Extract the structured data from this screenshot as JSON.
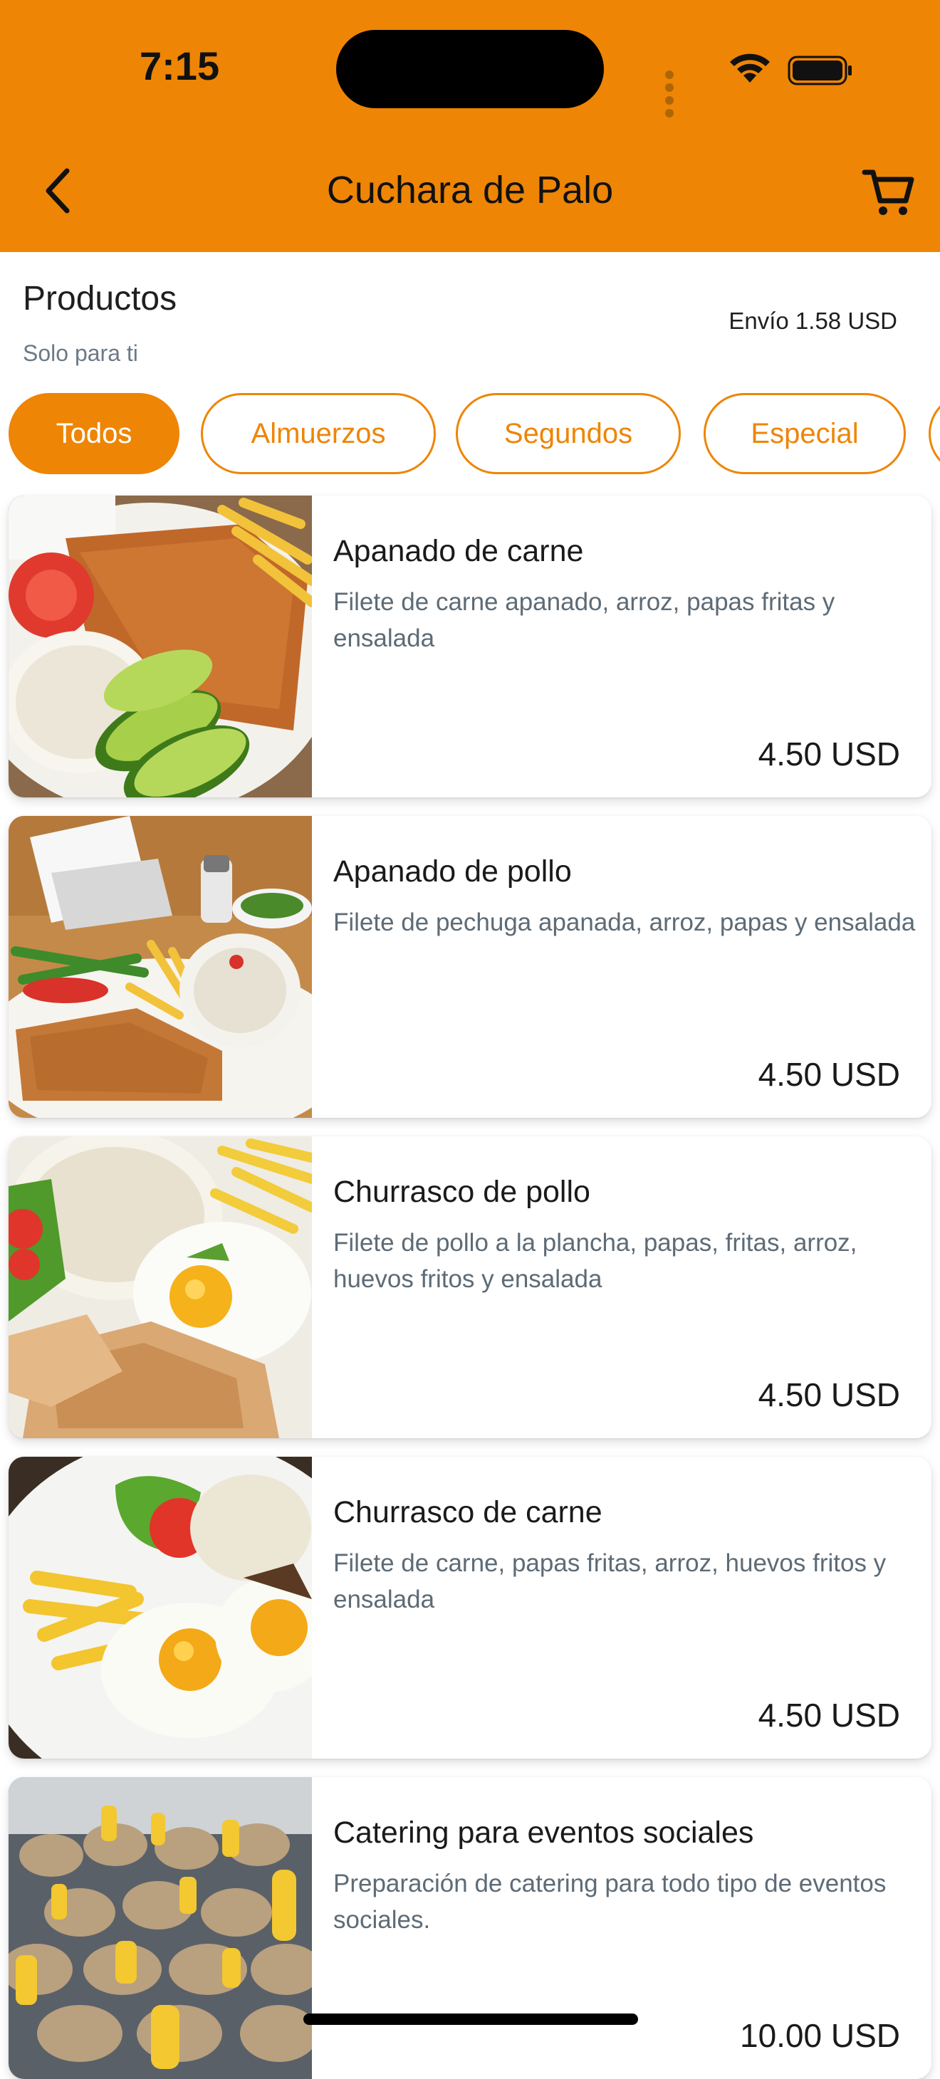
{
  "status_bar": {
    "time": "7:15"
  },
  "header": {
    "title": "Cuchara de Palo",
    "back_icon": "chevron-left-icon",
    "cart_icon": "cart-icon"
  },
  "section": {
    "title": "Productos",
    "subtitle": "Solo para ti",
    "shipping": "Envío 1.58 USD"
  },
  "tabs": [
    {
      "label": "Todos",
      "active": true
    },
    {
      "label": "Almuerzos",
      "active": false
    },
    {
      "label": "Segundos",
      "active": false
    },
    {
      "label": "Especial",
      "active": false
    }
  ],
  "products": [
    {
      "name": "Apanado de carne",
      "description": "Filete de carne apanado, arroz, papas fritas y ensalada",
      "price": "4.50 USD"
    },
    {
      "name": "Apanado de pollo",
      "description": "Filete de pechuga apanada, arroz, papas y ensalada",
      "price": "4.50 USD"
    },
    {
      "name": "Churrasco de pollo",
      "description": "Filete de pollo a la plancha, papas, fritas, arroz, huevos fritos y ensalada",
      "price": "4.50 USD"
    },
    {
      "name": "Churrasco de carne",
      "description": "Filete de carne, papas fritas, arroz, huevos fritos y ensalada",
      "price": "4.50 USD"
    },
    {
      "name": "Catering para eventos sociales",
      "description": "Preparación de catering para todo tipo de eventos sociales.",
      "price": "10.00 USD"
    }
  ],
  "colors": {
    "accent": "#EE8505",
    "muted_text": "#5d6b76"
  }
}
